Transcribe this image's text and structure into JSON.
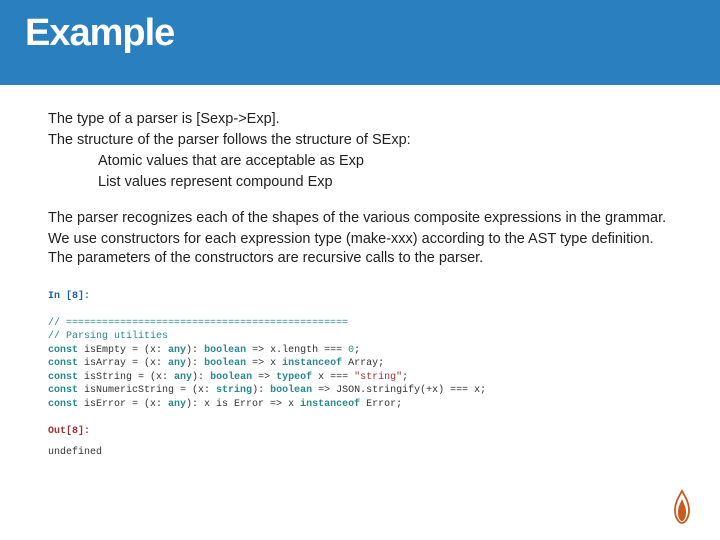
{
  "title": "Example",
  "body": {
    "line1": "The type of a parser is [Sexp->Exp].",
    "line2": "The structure of the parser follows the structure of SExp:",
    "line3": "Atomic values that are acceptable as Exp",
    "line4": "List values represent compound Exp",
    "line5": "The parser recognizes each of the shapes of the various composite expressions in  the grammar.",
    "line6": "We use constructors for each expression type (make-xxx)  according to the AST type definition. The parameters of the constructors are recursive calls to the parser."
  },
  "code": {
    "in_label": "In [8]:",
    "out_label": "Out[8]:",
    "comment1": "// ===============================================",
    "comment2": "// Parsing utilities",
    "l1_a": "const",
    "l1_b": " isEmpty = (x: ",
    "l1_c": "any",
    "l1_d": "): ",
    "l1_e": "boolean",
    "l1_f": " => x.length === ",
    "l1_g": "0",
    "l1_h": ";",
    "l2_a": "const",
    "l2_b": " isArray = (x: ",
    "l2_c": "any",
    "l2_d": "): ",
    "l2_e": "boolean",
    "l2_f": " => x ",
    "l2_g": "instanceof",
    "l2_h": " Array;",
    "l3_a": "const",
    "l3_b": " isString = (x: ",
    "l3_c": "any",
    "l3_d": "): ",
    "l3_e": "boolean",
    "l3_f": " => ",
    "l3_g": "typeof",
    "l3_h": " x === ",
    "l3_i": "\"string\"",
    "l3_j": ";",
    "l4_a": "const",
    "l4_b": " isNumericString = (x: ",
    "l4_c": "string",
    "l4_d": "): ",
    "l4_e": "boolean",
    "l4_f": " => JSON.stringify(+x) === x;",
    "l5_a": "const",
    "l5_b": " isError = (x: ",
    "l5_c": "any",
    "l5_d": "): x is Error => x ",
    "l5_e": "instanceof",
    "l5_f": " Error;",
    "out_val": "undefined"
  }
}
